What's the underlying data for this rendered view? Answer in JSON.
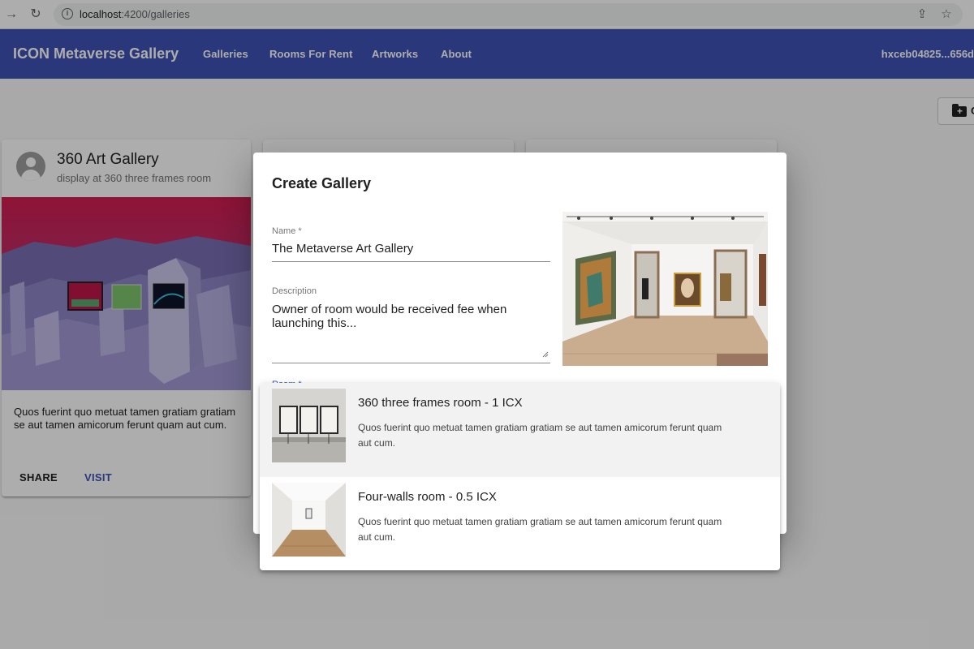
{
  "browser": {
    "url_host": "localhost",
    "url_path": ":4200/galleries"
  },
  "toolbar": {
    "title": "ICON Metaverse Gallery",
    "nav": [
      "Galleries",
      "Rooms For Rent",
      "Artworks",
      "About"
    ],
    "wallet": "hxceb04825...656d"
  },
  "page": {
    "create_button_label": "C"
  },
  "gallery_card": {
    "title": "360 Art Gallery",
    "subtitle": "display at 360 three frames room",
    "description": "Quos fuerint quo metuat tamen gratiam gratiam se aut tamen amicorum ferunt quam aut cum.",
    "share_label": "SHARE",
    "visit_label": "VISIT"
  },
  "dialog": {
    "title": "Create Gallery",
    "name_label": "Name *",
    "name_value": "The Metaverse Art Gallery",
    "description_label": "Description",
    "description_value": "Owner of room would be received fee when launching this...",
    "room_label": "Room *"
  },
  "room_options": [
    {
      "title": "360 three frames room - 1 ICX",
      "description": "Quos fuerint quo metuat tamen gratiam gratiam se aut tamen amicorum ferunt quam aut cum."
    },
    {
      "title": "Four-walls room - 0.5 ICX",
      "description": "Quos fuerint quo metuat tamen gratiam gratiam se aut tamen amicorum ferunt quam aut cum."
    }
  ],
  "colors": {
    "primary": "#3f51b5",
    "backdrop": "rgba(0,0,0,0.32)"
  }
}
